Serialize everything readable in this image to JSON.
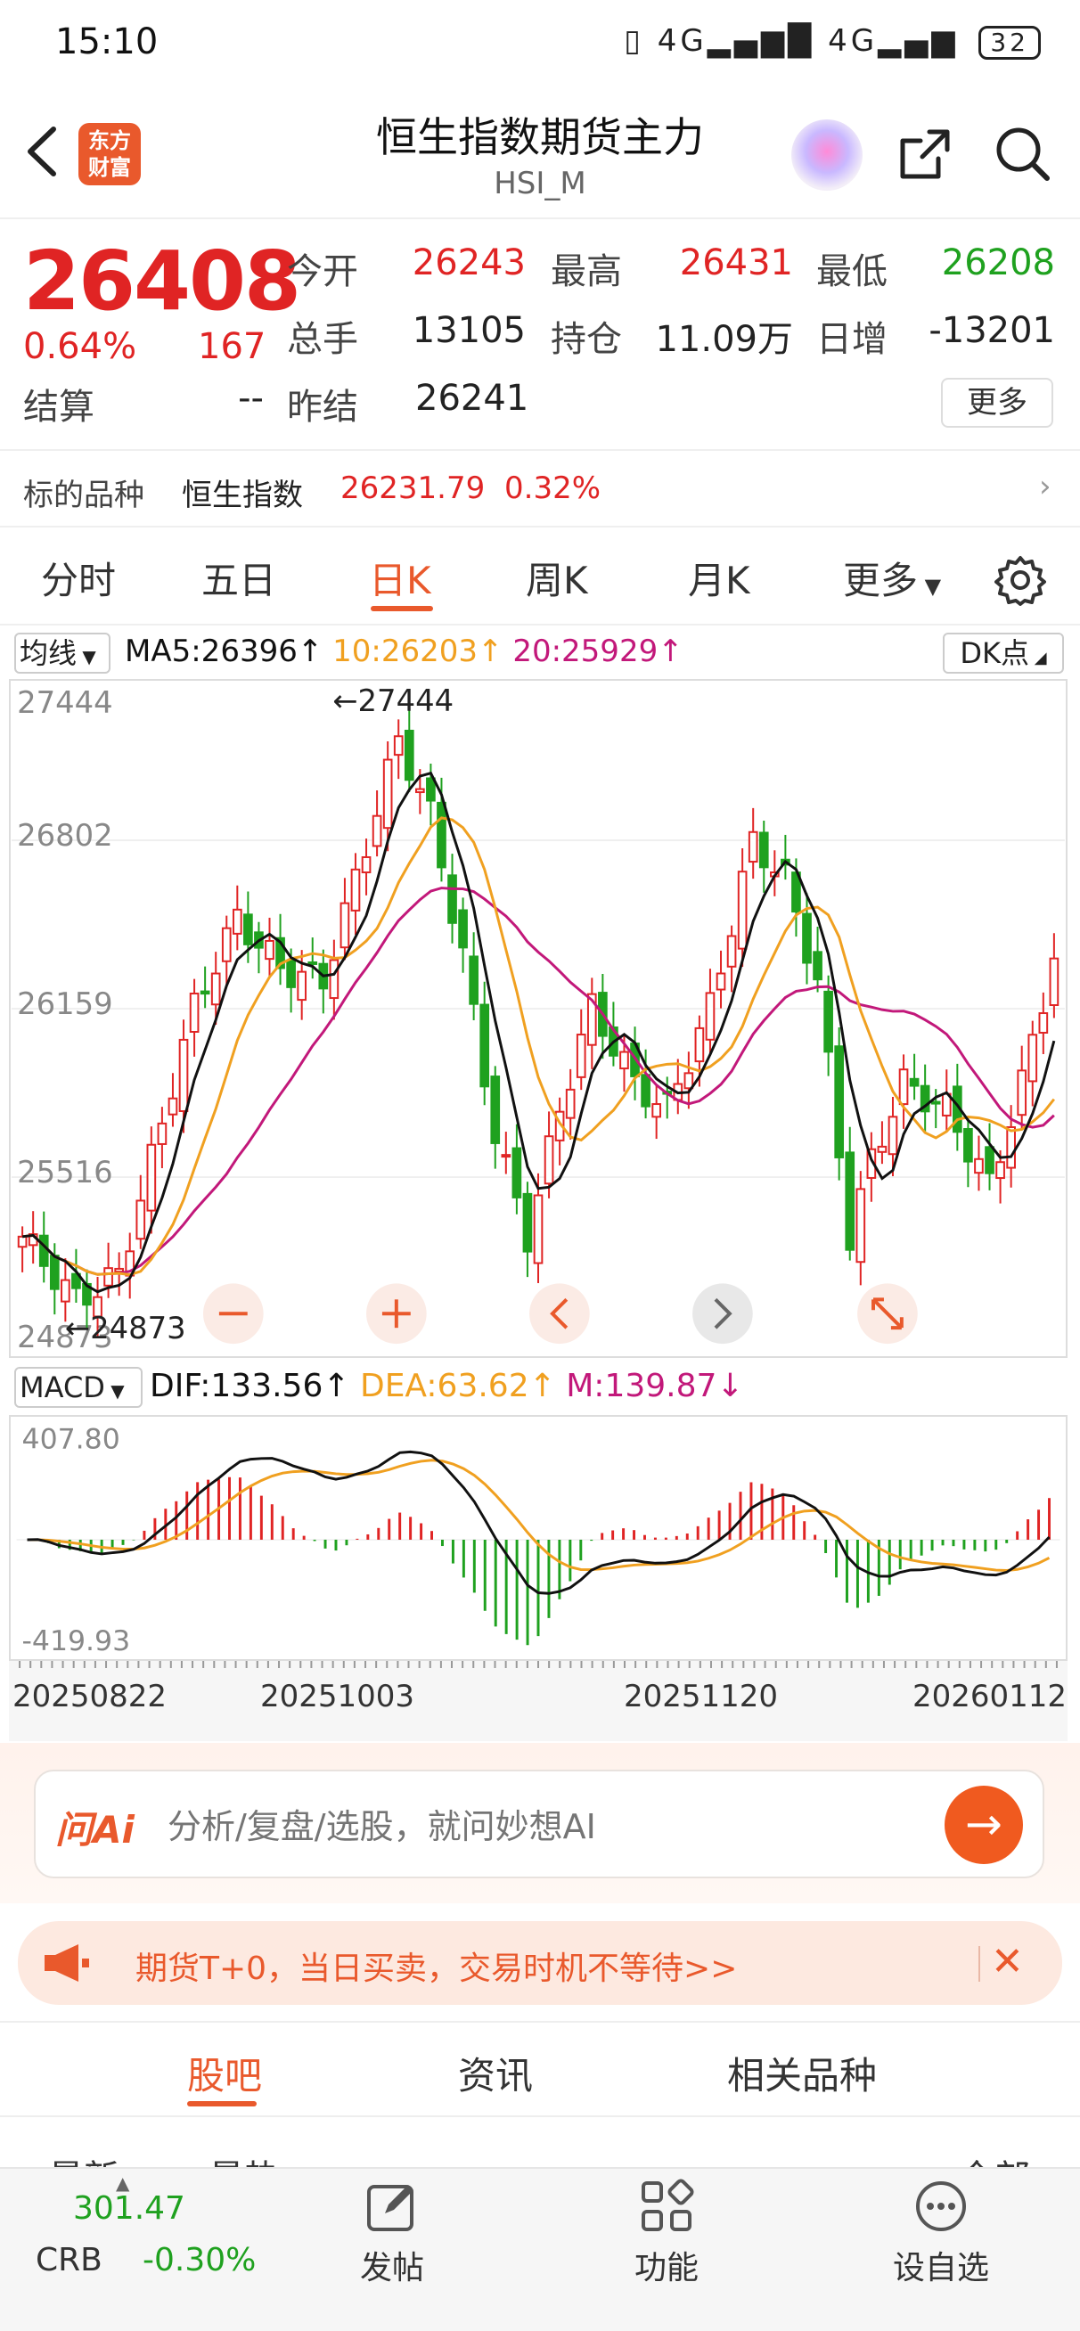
{
  "status": {
    "time": "15:10",
    "battery": "32",
    "net_left": "4G",
    "net_right": "4G"
  },
  "header": {
    "title": "恒生指数期货主力",
    "subtitle": "HSI_M",
    "logo_line1": "东方",
    "logo_line2": "财富"
  },
  "quote": {
    "price": "26408",
    "pct": "0.64%",
    "change": "167",
    "open_label": "今开",
    "open": "26243",
    "high_label": "最高",
    "high": "26431",
    "low_label": "最低",
    "low": "26208",
    "volume_label": "总手",
    "volume": "13105",
    "oi_label": "持仓",
    "oi": "11.09万",
    "day_inc_label": "日增",
    "day_inc": "-13201",
    "settle_label": "结算",
    "settle": "--",
    "prev_settle_label": "昨结",
    "prev_settle": "26241",
    "more_label": "更多"
  },
  "underlying": {
    "label": "标的品种",
    "name": "恒生指数",
    "value": "26231.79",
    "pct": "0.32%"
  },
  "tabs": [
    "分时",
    "五日",
    "日K",
    "周K",
    "月K",
    "更多"
  ],
  "ma": {
    "select": "均线",
    "ma5": "MA5:26396↑",
    "ma10": "10:26203↑",
    "ma20": "20:25929↑",
    "dk": "DK点"
  },
  "kline": {
    "y_labels": [
      "27444",
      "26802",
      "26159",
      "25516",
      "24873"
    ],
    "max_marker": "←27444",
    "min_marker": "←24873"
  },
  "macd": {
    "select": "MACD",
    "dif": "DIF:133.56↑",
    "dea": "DEA:63.62↑",
    "m": "M:139.87↓",
    "top": "407.80",
    "bottom": "-419.93"
  },
  "dates": [
    "20250822",
    "20251003",
    "20251120",
    "20260112"
  ],
  "ai": {
    "logo": "问Ai",
    "placeholder": "分析/复盘/选股，就问妙想AI"
  },
  "promo": {
    "text": "期货T+0，当日买卖，交易时机不等待>>"
  },
  "section_tabs": [
    "股吧",
    "资讯",
    "相关品种"
  ],
  "peek": {
    "left1": "最新",
    "left2": "最热",
    "right": "全部"
  },
  "bottom": {
    "crb_value": "301.47",
    "crb_name": "CRB",
    "crb_pct": "-0.30%",
    "nav": [
      "发帖",
      "功能",
      "设自选"
    ]
  },
  "colors": {
    "up": "#e02424",
    "down": "#1fa11f",
    "accent": "#e9592c",
    "ma5": "#111111",
    "ma10": "#f0a020",
    "ma20": "#c2187a"
  }
}
